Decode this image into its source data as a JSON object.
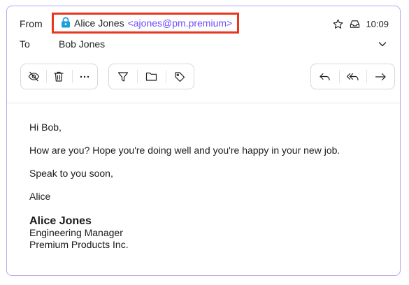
{
  "header": {
    "from_label": "From",
    "to_label": "To",
    "sender_name": "Alice Jones",
    "sender_email": "<ajones@pm.premium>",
    "recipient_name": "Bob Jones",
    "time": "10:09"
  },
  "toolbar": {
    "groups": [
      [
        "eye-slash-icon",
        "trash-icon",
        "more-icon"
      ],
      [
        "filter-icon",
        "folder-icon",
        "tag-icon"
      ],
      [
        "reply-icon",
        "reply-all-icon",
        "forward-icon"
      ]
    ]
  },
  "message": {
    "greeting": "Hi Bob,",
    "paragraph_1": "How are you? Hope you're doing well and you're happy in your new job.",
    "paragraph_2": "Speak to you soon,",
    "signoff": "Alice",
    "signature": {
      "name": "Alice Jones",
      "title": "Engineering Manager",
      "company": "Premium Products Inc."
    }
  },
  "colors": {
    "accent": "#6d4aff",
    "frame_border": "#b9a8ec",
    "highlight_border": "#e8351e",
    "lock": "#1ea0d6"
  }
}
